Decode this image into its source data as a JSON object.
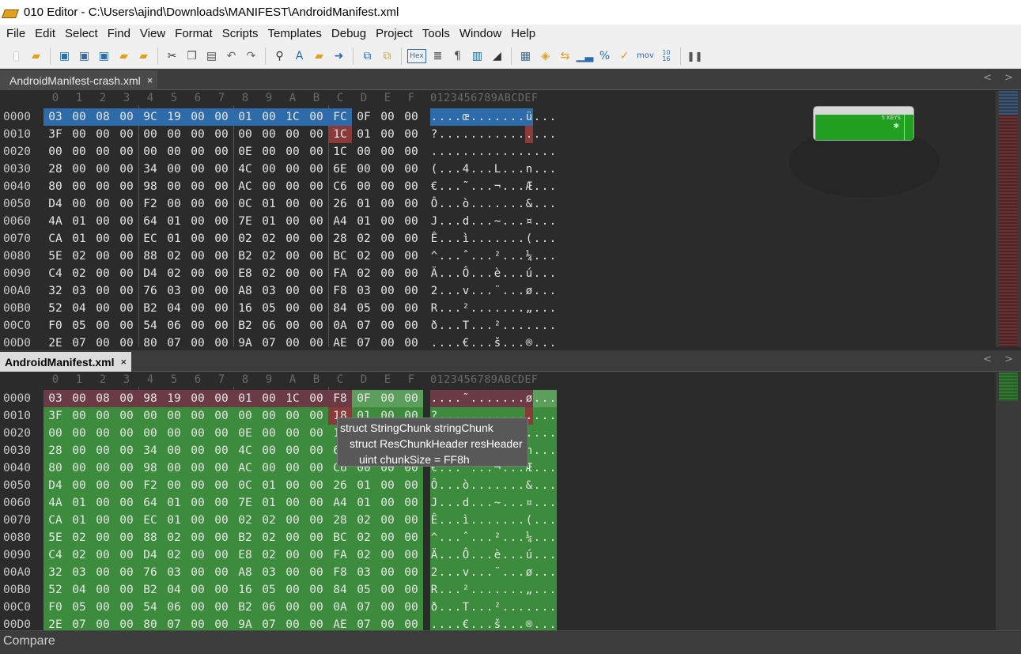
{
  "window": {
    "title": "010 Editor - C:\\Users\\ajind\\Downloads\\MANIFEST\\AndroidManifest.xml"
  },
  "menu": [
    "File",
    "Edit",
    "Select",
    "Find",
    "View",
    "Format",
    "Scripts",
    "Templates",
    "Debug",
    "Project",
    "Tools",
    "Window",
    "Help"
  ],
  "toolbar": {
    "hex_label": "Hex",
    "mov_label": "mov",
    "num_label": "10\n16"
  },
  "tabs": {
    "top": {
      "label": "AndroidManifest-crash.xml",
      "close": "×"
    },
    "bottom": {
      "label": "AndroidManifest.xml",
      "close": "×"
    },
    "arrows": "< >"
  },
  "hex_header": [
    "0",
    "1",
    "2",
    "3",
    "4",
    "5",
    "6",
    "7",
    "8",
    "9",
    "A",
    "B",
    "C",
    "D",
    "E",
    "F"
  ],
  "ascii_header": "0123456789ABCDEF",
  "pane_top": {
    "rows": [
      {
        "addr": "0000",
        "bytes": [
          "03",
          "00",
          "08",
          "00",
          "9C",
          "19",
          "00",
          "00",
          "01",
          "00",
          "1C",
          "00",
          "FC",
          "0F",
          "00",
          "00"
        ],
        "ascii": "....œ.......ü..."
      },
      {
        "addr": "0010",
        "bytes": [
          "3F",
          "00",
          "00",
          "00",
          "00",
          "00",
          "00",
          "00",
          "00",
          "00",
          "00",
          "00",
          "1C",
          "01",
          "00",
          "00"
        ],
        "ascii": "?..............."
      },
      {
        "addr": "0020",
        "bytes": [
          "00",
          "00",
          "00",
          "00",
          "00",
          "00",
          "00",
          "00",
          "0E",
          "00",
          "00",
          "00",
          "1C",
          "00",
          "00",
          "00"
        ],
        "ascii": "................"
      },
      {
        "addr": "0030",
        "bytes": [
          "28",
          "00",
          "00",
          "00",
          "34",
          "00",
          "00",
          "00",
          "4C",
          "00",
          "00",
          "00",
          "6E",
          "00",
          "00",
          "00"
        ],
        "ascii": "(...4...L...n..."
      },
      {
        "addr": "0040",
        "bytes": [
          "80",
          "00",
          "00",
          "00",
          "98",
          "00",
          "00",
          "00",
          "AC",
          "00",
          "00",
          "00",
          "C6",
          "00",
          "00",
          "00"
        ],
        "ascii": "€...˜...¬...Æ..."
      },
      {
        "addr": "0050",
        "bytes": [
          "D4",
          "00",
          "00",
          "00",
          "F2",
          "00",
          "00",
          "00",
          "0C",
          "01",
          "00",
          "00",
          "26",
          "01",
          "00",
          "00"
        ],
        "ascii": "Ô...ò.......&..."
      },
      {
        "addr": "0060",
        "bytes": [
          "4A",
          "01",
          "00",
          "00",
          "64",
          "01",
          "00",
          "00",
          "7E",
          "01",
          "00",
          "00",
          "A4",
          "01",
          "00",
          "00"
        ],
        "ascii": "J...d...~...¤..."
      },
      {
        "addr": "0070",
        "bytes": [
          "CA",
          "01",
          "00",
          "00",
          "EC",
          "01",
          "00",
          "00",
          "02",
          "02",
          "00",
          "00",
          "28",
          "02",
          "00",
          "00"
        ],
        "ascii": "Ê...ì.......(..."
      },
      {
        "addr": "0080",
        "bytes": [
          "5E",
          "02",
          "00",
          "00",
          "88",
          "02",
          "00",
          "00",
          "B2",
          "02",
          "00",
          "00",
          "BC",
          "02",
          "00",
          "00"
        ],
        "ascii": "^...ˆ...²...¼..."
      },
      {
        "addr": "0090",
        "bytes": [
          "C4",
          "02",
          "00",
          "00",
          "D4",
          "02",
          "00",
          "00",
          "E8",
          "02",
          "00",
          "00",
          "FA",
          "02",
          "00",
          "00"
        ],
        "ascii": "Ä...Ô...è...ú..."
      },
      {
        "addr": "00A0",
        "bytes": [
          "32",
          "03",
          "00",
          "00",
          "76",
          "03",
          "00",
          "00",
          "A8",
          "03",
          "00",
          "00",
          "F8",
          "03",
          "00",
          "00"
        ],
        "ascii": "2...v...¨...ø..."
      },
      {
        "addr": "00B0",
        "bytes": [
          "52",
          "04",
          "00",
          "00",
          "B2",
          "04",
          "00",
          "00",
          "16",
          "05",
          "00",
          "00",
          "84",
          "05",
          "00",
          "00"
        ],
        "ascii": "R...².......„..."
      },
      {
        "addr": "00C0",
        "bytes": [
          "F0",
          "05",
          "00",
          "00",
          "54",
          "06",
          "00",
          "00",
          "B2",
          "06",
          "00",
          "00",
          "0A",
          "07",
          "00",
          "00"
        ],
        "ascii": "ð...T...²......."
      },
      {
        "addr": "00D0",
        "bytes": [
          "2E",
          "07",
          "00",
          "00",
          "80",
          "07",
          "00",
          "00",
          "9A",
          "07",
          "00",
          "00",
          "AE",
          "07",
          "00",
          "00"
        ],
        "ascii": "....€...š...®..."
      }
    ]
  },
  "pane_bottom": {
    "rows": [
      {
        "addr": "0000",
        "bytes": [
          "03",
          "00",
          "08",
          "00",
          "98",
          "19",
          "00",
          "00",
          "01",
          "00",
          "1C",
          "00",
          "F8",
          "0F",
          "00",
          "00"
        ],
        "ascii": "....˜.......ø..."
      },
      {
        "addr": "0010",
        "bytes": [
          "3F",
          "00",
          "00",
          "00",
          "00",
          "00",
          "00",
          "00",
          "00",
          "00",
          "00",
          "00",
          "18",
          "01",
          "00",
          "00"
        ],
        "ascii": "?..............."
      },
      {
        "addr": "0020",
        "bytes": [
          "00",
          "00",
          "00",
          "00",
          "00",
          "00",
          "00",
          "00",
          "0E",
          "00",
          "00",
          "00",
          "18",
          "00",
          "00",
          "00"
        ],
        "ascii": "................"
      },
      {
        "addr": "0030",
        "bytes": [
          "28",
          "00",
          "00",
          "00",
          "34",
          "00",
          "00",
          "00",
          "4C",
          "00",
          "00",
          "00",
          "6A",
          "00",
          "00",
          "00"
        ],
        "ascii": "(...4...L...n..."
      },
      {
        "addr": "0040",
        "bytes": [
          "80",
          "00",
          "00",
          "00",
          "98",
          "00",
          "00",
          "00",
          "AC",
          "00",
          "00",
          "00",
          "C6",
          "00",
          "00",
          "00"
        ],
        "ascii": "€...˜...¬...Æ..."
      },
      {
        "addr": "0050",
        "bytes": [
          "D4",
          "00",
          "00",
          "00",
          "F2",
          "00",
          "00",
          "00",
          "0C",
          "01",
          "00",
          "00",
          "26",
          "01",
          "00",
          "00"
        ],
        "ascii": "Ô...ò.......&..."
      },
      {
        "addr": "0060",
        "bytes": [
          "4A",
          "01",
          "00",
          "00",
          "64",
          "01",
          "00",
          "00",
          "7E",
          "01",
          "00",
          "00",
          "A4",
          "01",
          "00",
          "00"
        ],
        "ascii": "J...d...~...¤..."
      },
      {
        "addr": "0070",
        "bytes": [
          "CA",
          "01",
          "00",
          "00",
          "EC",
          "01",
          "00",
          "00",
          "02",
          "02",
          "00",
          "00",
          "28",
          "02",
          "00",
          "00"
        ],
        "ascii": "Ê...ì.......(..."
      },
      {
        "addr": "0080",
        "bytes": [
          "5E",
          "02",
          "00",
          "00",
          "88",
          "02",
          "00",
          "00",
          "B2",
          "02",
          "00",
          "00",
          "BC",
          "02",
          "00",
          "00"
        ],
        "ascii": "^...ˆ...²...¼..."
      },
      {
        "addr": "0090",
        "bytes": [
          "C4",
          "02",
          "00",
          "00",
          "D4",
          "02",
          "00",
          "00",
          "E8",
          "02",
          "00",
          "00",
          "FA",
          "02",
          "00",
          "00"
        ],
        "ascii": "Ä...Ô...è...ú..."
      },
      {
        "addr": "00A0",
        "bytes": [
          "32",
          "03",
          "00",
          "00",
          "76",
          "03",
          "00",
          "00",
          "A8",
          "03",
          "00",
          "00",
          "F8",
          "03",
          "00",
          "00"
        ],
        "ascii": "2...v...¨...ø..."
      },
      {
        "addr": "00B0",
        "bytes": [
          "52",
          "04",
          "00",
          "00",
          "B2",
          "04",
          "00",
          "00",
          "16",
          "05",
          "00",
          "00",
          "84",
          "05",
          "00",
          "00"
        ],
        "ascii": "R...².......„..."
      },
      {
        "addr": "00C0",
        "bytes": [
          "F0",
          "05",
          "00",
          "00",
          "54",
          "06",
          "00",
          "00",
          "B2",
          "06",
          "00",
          "00",
          "0A",
          "07",
          "00",
          "00"
        ],
        "ascii": "ð...T...²......."
      },
      {
        "addr": "00D0",
        "bytes": [
          "2E",
          "07",
          "00",
          "00",
          "80",
          "07",
          "00",
          "00",
          "9A",
          "07",
          "00",
          "00",
          "AE",
          "07",
          "00",
          "00"
        ],
        "ascii": "....€...š...®..."
      }
    ]
  },
  "tooltip": {
    "line1": "struct StringChunk stringChunk",
    "line2": "struct ResChunkHeader resHeader",
    "line3": "uint chunkSize = FF8h"
  },
  "mini_widget": {
    "label": "5 KEYS"
  },
  "statusbar": {
    "label": "Compare"
  },
  "colors": {
    "selection_blue": "#2d6baa",
    "diff_red": "#8b3a3a",
    "template_green": "#3d8b3d",
    "background": "#2b2b2b"
  }
}
